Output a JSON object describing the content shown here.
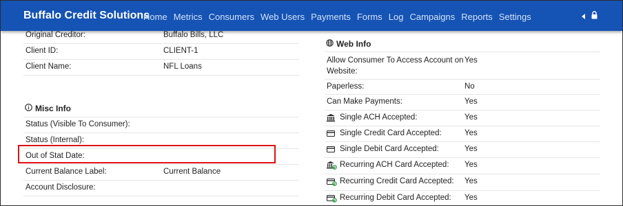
{
  "navbar": {
    "brand": "Buffalo Credit Solutions",
    "links": [
      "Home",
      "Metrics",
      "Consumers",
      "Web Users",
      "Payments",
      "Forms",
      "Log",
      "Campaigns",
      "Reports",
      "Settings"
    ]
  },
  "left_top_rows": [
    {
      "label": "Original Creditor:",
      "value": "Buffalo Bills, LLC"
    },
    {
      "label": "Client ID:",
      "value": "CLIENT-1"
    },
    {
      "label": "Client Name:",
      "value": "NFL Loans"
    }
  ],
  "misc_info": {
    "title": "Misc Info",
    "icon": "info-circle-icon",
    "rows": [
      {
        "label": "Status (Visible To Consumer):",
        "value": ""
      },
      {
        "label": "Status (Internal):",
        "value": ""
      },
      {
        "label": "Out of Stat Date:",
        "value": ""
      },
      {
        "label": "Current Balance Label:",
        "value": "Current Balance"
      },
      {
        "label": "Account Disclosure:",
        "value": ""
      }
    ]
  },
  "web_info": {
    "title": "Web Info",
    "icon": "globe-icon",
    "rows": [
      {
        "label": "Allow Consumer To Access Account on Website:",
        "label_line1": "Allow Consumer To Access Account on",
        "label_line2": "Website:",
        "value": "Yes",
        "icon": ""
      },
      {
        "label": "Paperless:",
        "value": "No",
        "icon": ""
      },
      {
        "label": "Can Make Payments:",
        "value": "Yes",
        "icon": ""
      },
      {
        "label": "Single ACH Accepted:",
        "value": "Yes",
        "icon": "bank-icon"
      },
      {
        "label": "Single Credit Card Accepted:",
        "value": "Yes",
        "icon": "credit-card-icon"
      },
      {
        "label": "Single Debit Card Accepted:",
        "value": "Yes",
        "icon": "debit-card-icon"
      },
      {
        "label": "Recurring ACH Card Accepted:",
        "value": "Yes",
        "icon": "bank-recurring-icon"
      },
      {
        "label": "Recurring Credit Card Accepted:",
        "value": "Yes",
        "icon": "credit-card-recurring-icon"
      },
      {
        "label": "Recurring Debit Card Accepted:",
        "value": "Yes",
        "icon": "debit-card-recurring-icon"
      }
    ]
  },
  "colors": {
    "navbar_bg": "#1553b4",
    "highlight_border": "#e01010"
  }
}
